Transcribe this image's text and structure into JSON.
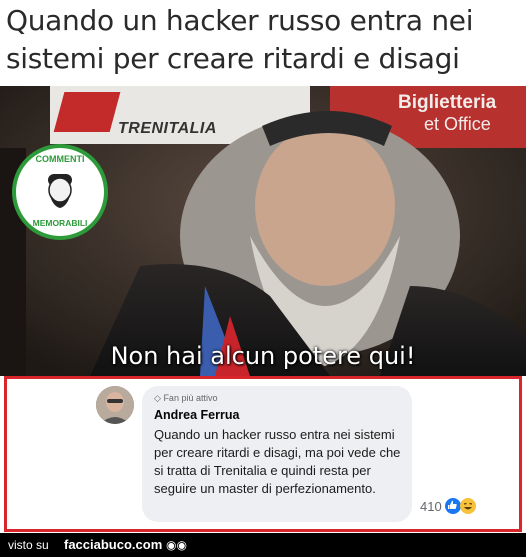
{
  "title": "Quando un hacker russo entra nei sistemi per creare ritardi e disagi",
  "photo": {
    "sign_right_line1": "Biglietteria",
    "sign_right_line2": "et Office",
    "sign_brand": "TRENITALIA",
    "badge_top": "COMMENTI",
    "badge_bottom": "MEMORABILI",
    "caption": "Non hai alcun potere qui!"
  },
  "comment": {
    "fan_badge": "Fan più attivo",
    "author": "Andrea Ferrua",
    "text": "Quando un hacker russo entra nei sistemi per creare ritardi e disagi, ma poi vede che si tratta di Trenitalia e quindi resta per seguire un master di perfezionamento.",
    "reaction_count": "410"
  },
  "footer": {
    "visto_su": "visto su",
    "site": "facciabuco.com"
  },
  "colors": {
    "frame_red": "#d8262c",
    "badge_green": "#2d9b3a",
    "like_blue": "#1877f2"
  }
}
